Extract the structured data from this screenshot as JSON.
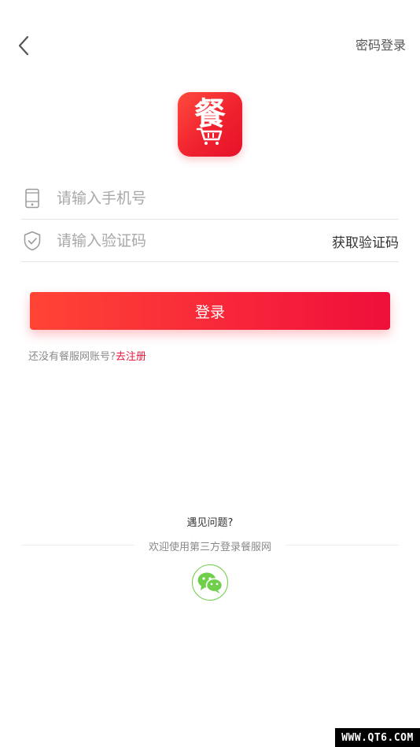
{
  "header": {
    "password_login_label": "密码登录"
  },
  "logo": {
    "glyph": "餐"
  },
  "form": {
    "phone_placeholder": "请输入手机号",
    "code_placeholder": "请输入验证码",
    "get_code_label": "获取验证码",
    "login_label": "登录"
  },
  "register": {
    "prompt": "还没有餐服网账号?",
    "link": "去注册"
  },
  "footer": {
    "problem_label": "遇见问题?",
    "third_party_label": "欢迎使用第三方登录餐服网"
  },
  "watermark": "WWW.QT6.COM",
  "colors": {
    "accent": "#f0223a",
    "wechat_green": "#6fcf4a",
    "link_red": "#e8163c"
  },
  "icons": {
    "back": "chevron-left-icon",
    "phone": "phone-icon",
    "shield": "shield-check-icon",
    "wechat": "wechat-icon",
    "cart": "cart-icon"
  }
}
